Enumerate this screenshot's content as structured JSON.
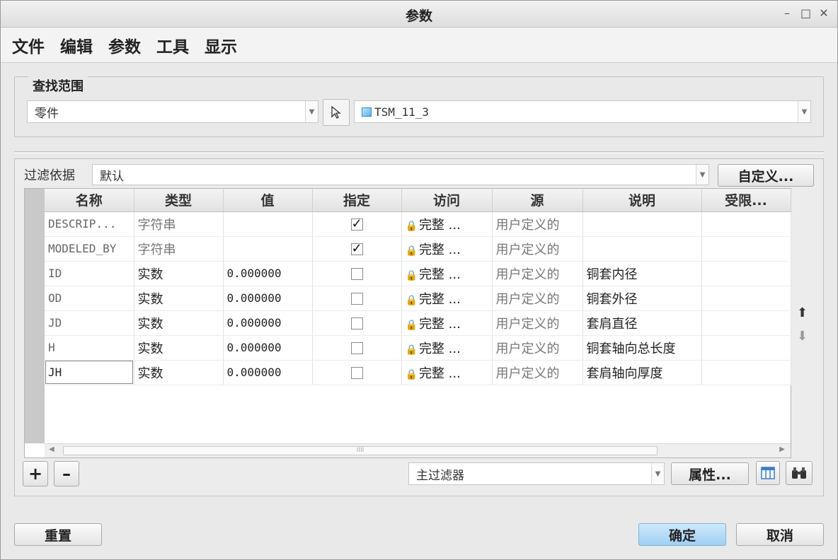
{
  "window": {
    "title": "参数",
    "controls": [
      "–",
      "□",
      "✕"
    ]
  },
  "menu": [
    "文件",
    "编辑",
    "参数",
    "工具",
    "显示"
  ],
  "scope": {
    "legend": "查找范围",
    "type_value": "零件",
    "model_value": "TSM_11_3"
  },
  "filter": {
    "label": "过滤依据",
    "value": "默认",
    "customize_label": "自定义..."
  },
  "table": {
    "headers": [
      "名称",
      "类型",
      "值",
      "指定",
      "访问",
      "源",
      "说明",
      "受限..."
    ],
    "rows": [
      {
        "name": "DESCRIP...",
        "type": "字符串",
        "value": "",
        "designated": true,
        "access": "完整 ...",
        "source": "用户定义的",
        "desc": ""
      },
      {
        "name": "MODELED_BY",
        "type": "字符串",
        "value": "",
        "designated": true,
        "access": "完整 ...",
        "source": "用户定义的",
        "desc": ""
      },
      {
        "name": "ID",
        "type": "实数",
        "value": "0.000000",
        "designated": false,
        "access": "完整 ...",
        "source": "用户定义的",
        "desc": "铜套内径"
      },
      {
        "name": "OD",
        "type": "实数",
        "value": "0.000000",
        "designated": false,
        "access": "完整 ...",
        "source": "用户定义的",
        "desc": "铜套外径"
      },
      {
        "name": "JD",
        "type": "实数",
        "value": "0.000000",
        "designated": false,
        "access": "完整 ...",
        "source": "用户定义的",
        "desc": "套肩直径"
      },
      {
        "name": "H",
        "type": "实数",
        "value": "0.000000",
        "designated": false,
        "access": "完整 ...",
        "source": "用户定义的",
        "desc": "铜套轴向总长度"
      },
      {
        "name": "JH",
        "type": "实数",
        "value": "0.000000",
        "designated": false,
        "access": "完整 ...",
        "source": "用户定义的",
        "desc": "套肩轴向厚度"
      }
    ],
    "scroll_thumb": "IIII"
  },
  "toolbar": {
    "add": "+",
    "remove": "–",
    "main_filter": "主过滤器",
    "properties": "属性..."
  },
  "footer": {
    "reset": "重置",
    "ok": "确定",
    "cancel": "取消"
  }
}
